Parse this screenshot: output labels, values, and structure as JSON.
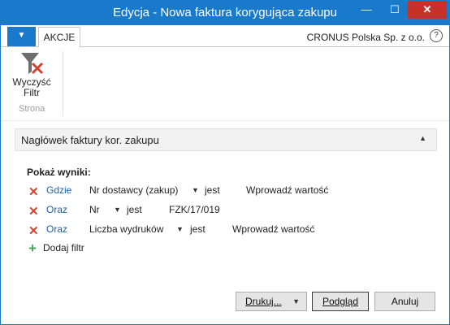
{
  "window": {
    "title": "Edycja - Nowa faktura korygująca zakupu",
    "min_glyph": "—",
    "max_glyph": "☐",
    "close_glyph": "✕"
  },
  "ribbon": {
    "menu_glyph": "▼",
    "tab_label": "AKCJE",
    "company": "CRONUS Polska Sp. z o.o.",
    "help_glyph": "?",
    "clear_filter_line1": "Wyczyść",
    "clear_filter_line2": "Filtr",
    "group_label": "Strona"
  },
  "fasttab": {
    "title": "Nagłówek faktury kor. zakupu",
    "caret": "▲"
  },
  "filter": {
    "heading": "Pokaż wyniki:",
    "rows": [
      {
        "keyword": "Gdzie",
        "field": "Nr dostawcy (zakup)",
        "operator": "jest",
        "value": "Wprowadź wartość"
      },
      {
        "keyword": "Oraz",
        "field": "Nr",
        "operator": "jest",
        "value": "FZK/17/019"
      },
      {
        "keyword": "Oraz",
        "field": "Liczba wydruków",
        "operator": "jest",
        "value": "Wprowadź wartość"
      }
    ],
    "add_label": "Dodaj filtr",
    "remove_glyph": "✕",
    "add_glyph": "+",
    "dropdown_glyph": "▼"
  },
  "buttons": {
    "print": "Drukuj...",
    "preview": "Podgląd",
    "cancel": "Anuluj"
  },
  "colors": {
    "accent": "#1979ca",
    "close": "#c7312a",
    "remove": "#d2442f",
    "add": "#49a35b",
    "link": "#1b5faa"
  }
}
